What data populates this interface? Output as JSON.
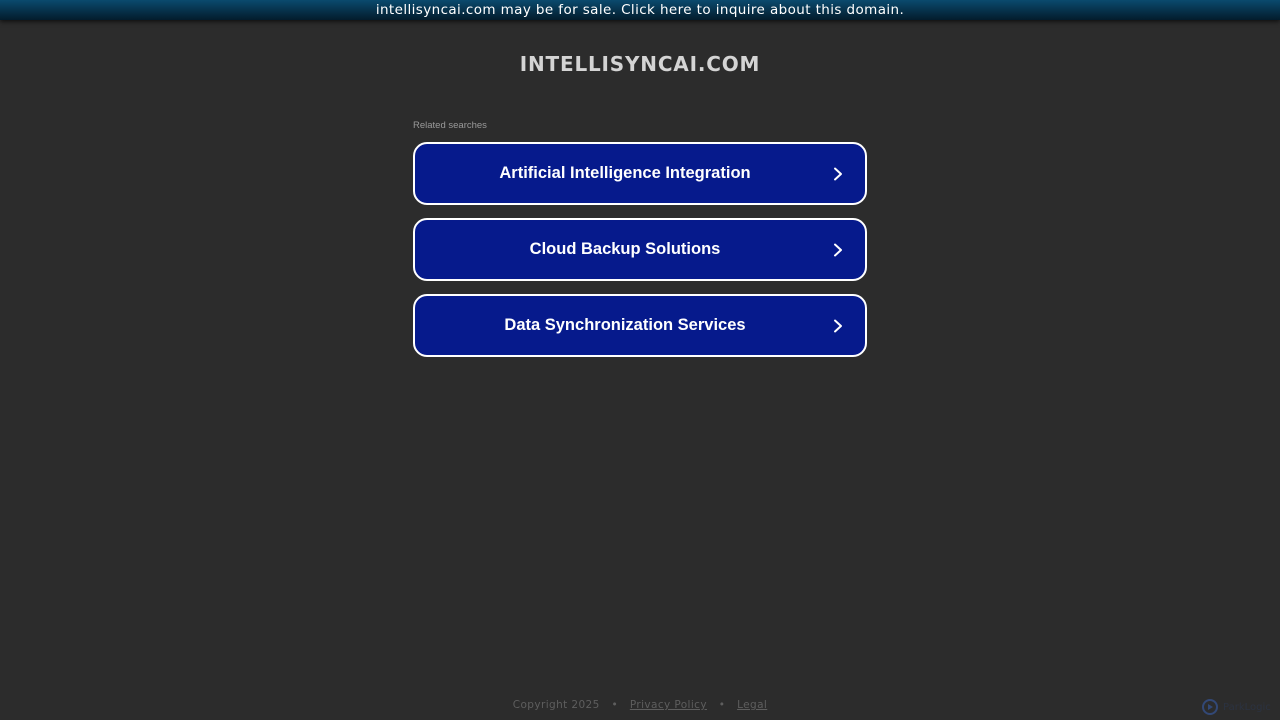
{
  "banner": {
    "text": "intellisyncai.com may be for sale. Click here to inquire about this domain."
  },
  "header": {
    "domain_title": "INTELLISYNCAI.COM"
  },
  "related_searches": {
    "label": "Related searches",
    "items": [
      {
        "label": "Artificial Intelligence Integration",
        "icon": "chevron-right-icon"
      },
      {
        "label": "Cloud Backup Solutions",
        "icon": "chevron-right-icon"
      },
      {
        "label": "Data Synchronization Services",
        "icon": "chevron-right-icon"
      }
    ]
  },
  "footer": {
    "copyright": "Copyright 2025",
    "separator": "•",
    "privacy_label": "Privacy Policy",
    "legal_label": "Legal"
  },
  "parked_logo": {
    "text": "ParkLogic",
    "icon": "parklogic-logo-icon"
  },
  "colors": {
    "background": "#2c2c2c",
    "button_fill": "#061a8c",
    "button_border": "#ffffff",
    "banner": "#062e46",
    "title": "#d4d4d4"
  }
}
